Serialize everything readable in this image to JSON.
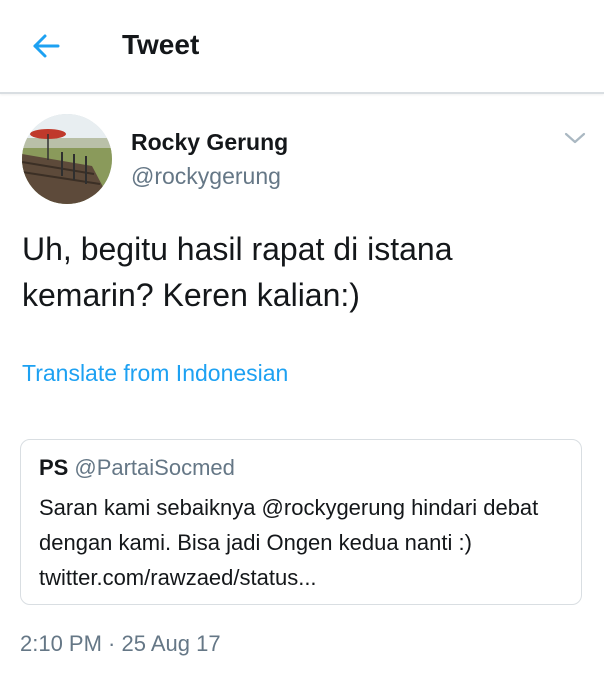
{
  "header": {
    "back_icon": "arrow-left-icon",
    "title": "Tweet"
  },
  "colors": {
    "accent": "#1da1f2",
    "text_primary": "#14171a",
    "text_secondary": "#657786",
    "border": "#d9dee2"
  },
  "tweet": {
    "author": {
      "name": "Rocky Gerung",
      "handle": "@rockygerung",
      "avatar_icon": "profile-photo"
    },
    "more_icon": "chevron-down-icon",
    "text": "Uh, begitu hasil rapat di istana kemarin? Keren kalian:)",
    "translate_label": "Translate from Indonesian",
    "quoted": {
      "name": "PS",
      "handle": "@PartaiSocmed",
      "text": "Saran kami sebaiknya @rockygerung hindari debat dengan kami. Bisa jadi Ongen kedua nanti :) twitter.com/rawzaed/status..."
    },
    "timestamp": "2:10 PM · 25 Aug 17"
  }
}
